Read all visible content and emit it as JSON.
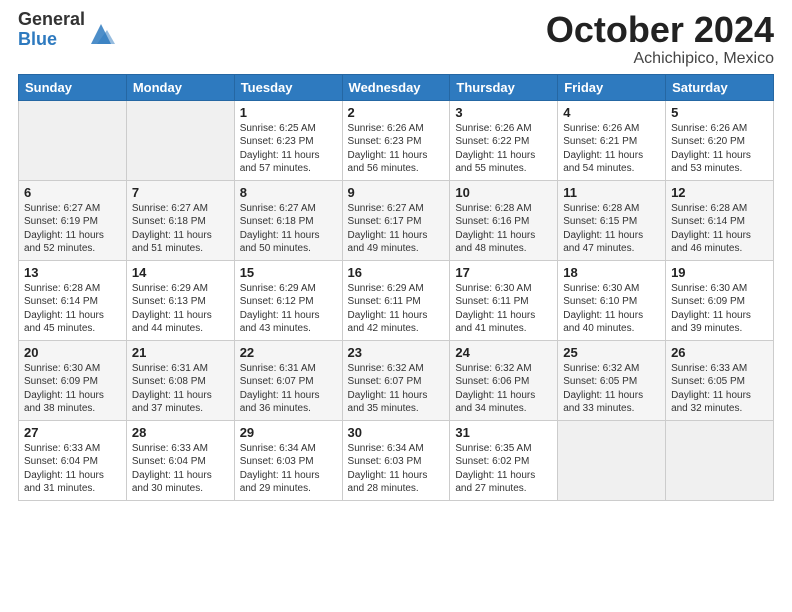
{
  "header": {
    "logo_general": "General",
    "logo_blue": "Blue",
    "month_title": "October 2024",
    "location": "Achichipico, Mexico"
  },
  "weekdays": [
    "Sunday",
    "Monday",
    "Tuesday",
    "Wednesday",
    "Thursday",
    "Friday",
    "Saturday"
  ],
  "weeks": [
    [
      {
        "day": "",
        "info": ""
      },
      {
        "day": "",
        "info": ""
      },
      {
        "day": "1",
        "info": "Sunrise: 6:25 AM\nSunset: 6:23 PM\nDaylight: 11 hours and 57 minutes."
      },
      {
        "day": "2",
        "info": "Sunrise: 6:26 AM\nSunset: 6:23 PM\nDaylight: 11 hours and 56 minutes."
      },
      {
        "day": "3",
        "info": "Sunrise: 6:26 AM\nSunset: 6:22 PM\nDaylight: 11 hours and 55 minutes."
      },
      {
        "day": "4",
        "info": "Sunrise: 6:26 AM\nSunset: 6:21 PM\nDaylight: 11 hours and 54 minutes."
      },
      {
        "day": "5",
        "info": "Sunrise: 6:26 AM\nSunset: 6:20 PM\nDaylight: 11 hours and 53 minutes."
      }
    ],
    [
      {
        "day": "6",
        "info": "Sunrise: 6:27 AM\nSunset: 6:19 PM\nDaylight: 11 hours and 52 minutes."
      },
      {
        "day": "7",
        "info": "Sunrise: 6:27 AM\nSunset: 6:18 PM\nDaylight: 11 hours and 51 minutes."
      },
      {
        "day": "8",
        "info": "Sunrise: 6:27 AM\nSunset: 6:18 PM\nDaylight: 11 hours and 50 minutes."
      },
      {
        "day": "9",
        "info": "Sunrise: 6:27 AM\nSunset: 6:17 PM\nDaylight: 11 hours and 49 minutes."
      },
      {
        "day": "10",
        "info": "Sunrise: 6:28 AM\nSunset: 6:16 PM\nDaylight: 11 hours and 48 minutes."
      },
      {
        "day": "11",
        "info": "Sunrise: 6:28 AM\nSunset: 6:15 PM\nDaylight: 11 hours and 47 minutes."
      },
      {
        "day": "12",
        "info": "Sunrise: 6:28 AM\nSunset: 6:14 PM\nDaylight: 11 hours and 46 minutes."
      }
    ],
    [
      {
        "day": "13",
        "info": "Sunrise: 6:28 AM\nSunset: 6:14 PM\nDaylight: 11 hours and 45 minutes."
      },
      {
        "day": "14",
        "info": "Sunrise: 6:29 AM\nSunset: 6:13 PM\nDaylight: 11 hours and 44 minutes."
      },
      {
        "day": "15",
        "info": "Sunrise: 6:29 AM\nSunset: 6:12 PM\nDaylight: 11 hours and 43 minutes."
      },
      {
        "day": "16",
        "info": "Sunrise: 6:29 AM\nSunset: 6:11 PM\nDaylight: 11 hours and 42 minutes."
      },
      {
        "day": "17",
        "info": "Sunrise: 6:30 AM\nSunset: 6:11 PM\nDaylight: 11 hours and 41 minutes."
      },
      {
        "day": "18",
        "info": "Sunrise: 6:30 AM\nSunset: 6:10 PM\nDaylight: 11 hours and 40 minutes."
      },
      {
        "day": "19",
        "info": "Sunrise: 6:30 AM\nSunset: 6:09 PM\nDaylight: 11 hours and 39 minutes."
      }
    ],
    [
      {
        "day": "20",
        "info": "Sunrise: 6:30 AM\nSunset: 6:09 PM\nDaylight: 11 hours and 38 minutes."
      },
      {
        "day": "21",
        "info": "Sunrise: 6:31 AM\nSunset: 6:08 PM\nDaylight: 11 hours and 37 minutes."
      },
      {
        "day": "22",
        "info": "Sunrise: 6:31 AM\nSunset: 6:07 PM\nDaylight: 11 hours and 36 minutes."
      },
      {
        "day": "23",
        "info": "Sunrise: 6:32 AM\nSunset: 6:07 PM\nDaylight: 11 hours and 35 minutes."
      },
      {
        "day": "24",
        "info": "Sunrise: 6:32 AM\nSunset: 6:06 PM\nDaylight: 11 hours and 34 minutes."
      },
      {
        "day": "25",
        "info": "Sunrise: 6:32 AM\nSunset: 6:05 PM\nDaylight: 11 hours and 33 minutes."
      },
      {
        "day": "26",
        "info": "Sunrise: 6:33 AM\nSunset: 6:05 PM\nDaylight: 11 hours and 32 minutes."
      }
    ],
    [
      {
        "day": "27",
        "info": "Sunrise: 6:33 AM\nSunset: 6:04 PM\nDaylight: 11 hours and 31 minutes."
      },
      {
        "day": "28",
        "info": "Sunrise: 6:33 AM\nSunset: 6:04 PM\nDaylight: 11 hours and 30 minutes."
      },
      {
        "day": "29",
        "info": "Sunrise: 6:34 AM\nSunset: 6:03 PM\nDaylight: 11 hours and 29 minutes."
      },
      {
        "day": "30",
        "info": "Sunrise: 6:34 AM\nSunset: 6:03 PM\nDaylight: 11 hours and 28 minutes."
      },
      {
        "day": "31",
        "info": "Sunrise: 6:35 AM\nSunset: 6:02 PM\nDaylight: 11 hours and 27 minutes."
      },
      {
        "day": "",
        "info": ""
      },
      {
        "day": "",
        "info": ""
      }
    ]
  ]
}
